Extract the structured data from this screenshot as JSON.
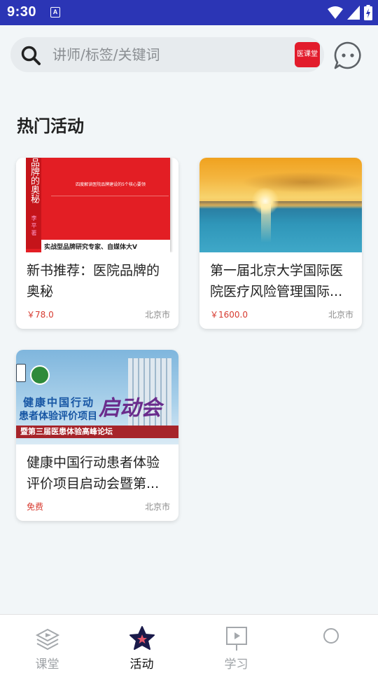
{
  "status_bar": {
    "time": "9:30",
    "notification_glyph": "A"
  },
  "search": {
    "placeholder": "讲师/标签/关键词",
    "brand_badge": "医课堂"
  },
  "section_title": "热门活动",
  "cards": [
    {
      "title": "新书推荐：医院品牌的奥秘",
      "price": "￥78.0",
      "city": "北京市",
      "image": {
        "spine_text": "品牌的奥秘",
        "author": "李 平 著",
        "cover_top": "四度解读医院品牌建设的5个核心要领",
        "cover_bottom": "实战型品牌研究专家、自媒体大V"
      }
    },
    {
      "title": "第一届北京大学国际医院医疗风险管理国际...",
      "price": "￥1600.0",
      "city": "北京市",
      "image": {}
    },
    {
      "title": "健康中国行动患者体验评价项目启动会暨第...",
      "price": "免费",
      "city": "北京市",
      "image": {
        "line1": "健康中国行动",
        "line2": "患者体验评价项目",
        "big": "启动会",
        "banner": "暨第三届医患体验高峰论坛"
      }
    }
  ],
  "tabs": [
    {
      "label": "课堂",
      "icon": "book-layers-icon",
      "active": false
    },
    {
      "label": "活动",
      "icon": "star-icon",
      "active": true
    },
    {
      "label": "学习",
      "icon": "presentation-icon",
      "active": false
    },
    {
      "label": "",
      "icon": "circle-icon",
      "active": false
    }
  ],
  "colors": {
    "status_bar": "#2b35b5",
    "price": "#d73a2f",
    "brand": "#e21b2b",
    "active_tab_icon": "#1a1a4a"
  }
}
